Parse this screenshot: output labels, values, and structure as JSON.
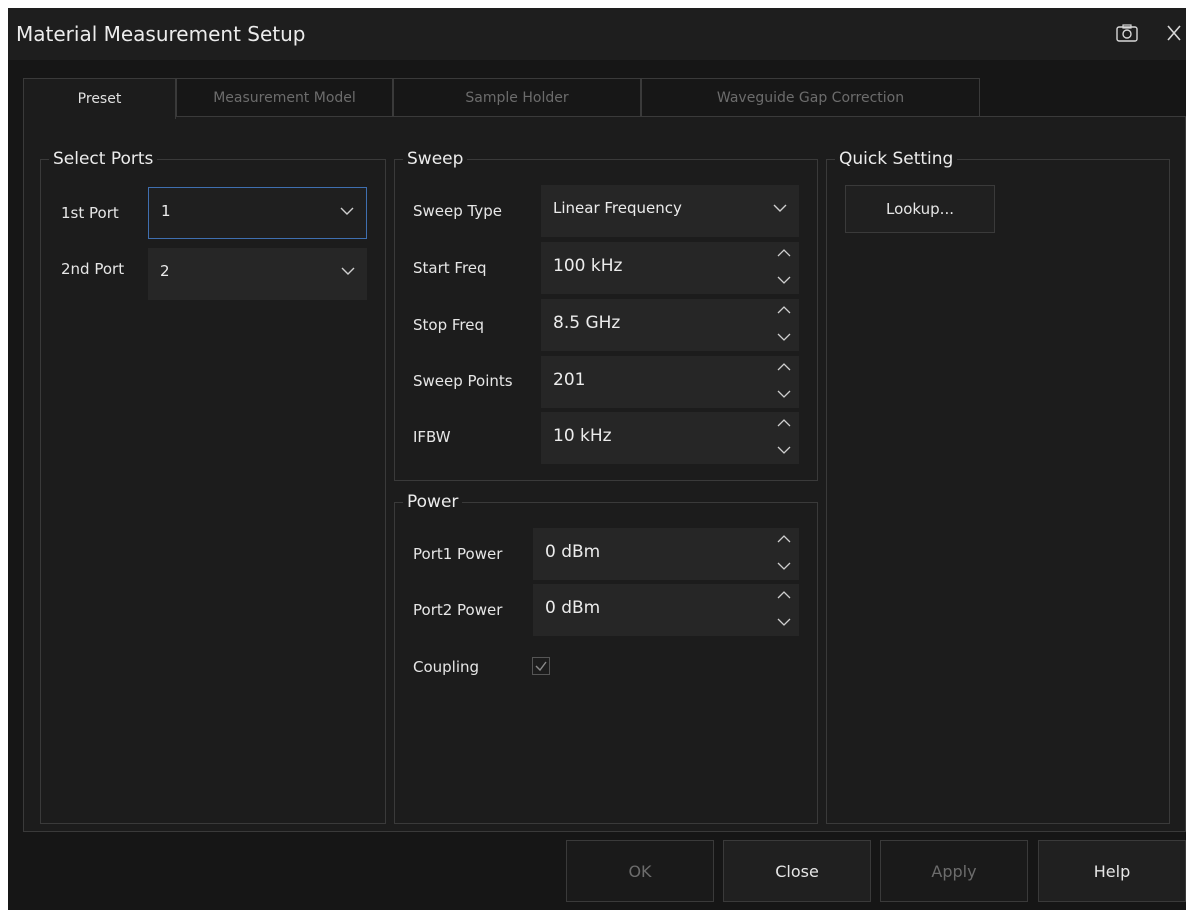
{
  "dialog": {
    "title": "Material Measurement Setup"
  },
  "tabs": [
    {
      "label": "Preset",
      "active": true
    },
    {
      "label": "Measurement Model",
      "active": false
    },
    {
      "label": "Sample Holder",
      "active": false
    },
    {
      "label": "Waveguide Gap Correction",
      "active": false
    }
  ],
  "select_ports": {
    "legend": "Select Ports",
    "first_port": {
      "label": "1st Port",
      "value": "1"
    },
    "second_port": {
      "label": "2nd Port",
      "value": "2"
    }
  },
  "sweep": {
    "legend": "Sweep",
    "sweep_type": {
      "label": "Sweep Type",
      "value": "Linear Frequency"
    },
    "start_freq": {
      "label": "Start Freq",
      "value": "100 kHz"
    },
    "stop_freq": {
      "label": "Stop Freq",
      "value": "8.5 GHz"
    },
    "sweep_points": {
      "label": "Sweep Points",
      "value": "201"
    },
    "ifbw": {
      "label": "IFBW",
      "value": "10 kHz"
    }
  },
  "power": {
    "legend": "Power",
    "port1": {
      "label": "Port1 Power",
      "value": "0 dBm"
    },
    "port2": {
      "label": "Port2 Power",
      "value": "0 dBm"
    },
    "coupling": {
      "label": "Coupling",
      "checked": true
    }
  },
  "quick_setting": {
    "legend": "Quick Setting",
    "lookup_label": "Lookup..."
  },
  "footer": {
    "ok_label": "OK",
    "close_label": "Close",
    "apply_label": "Apply",
    "help_label": "Help"
  },
  "icons": {
    "camera": "camera-icon",
    "close": "close-icon",
    "dropdown": "chevron-down-icon",
    "spin_up": "chevron-up-icon",
    "spin_down": "chevron-down-icon",
    "check": "check-icon"
  },
  "colors": {
    "background": "#1c1c1c",
    "titlebar": "#1e1e1e",
    "field": "#262626",
    "focus_border": "#3f6fb0",
    "disabled_text": "#6c6c6c"
  }
}
